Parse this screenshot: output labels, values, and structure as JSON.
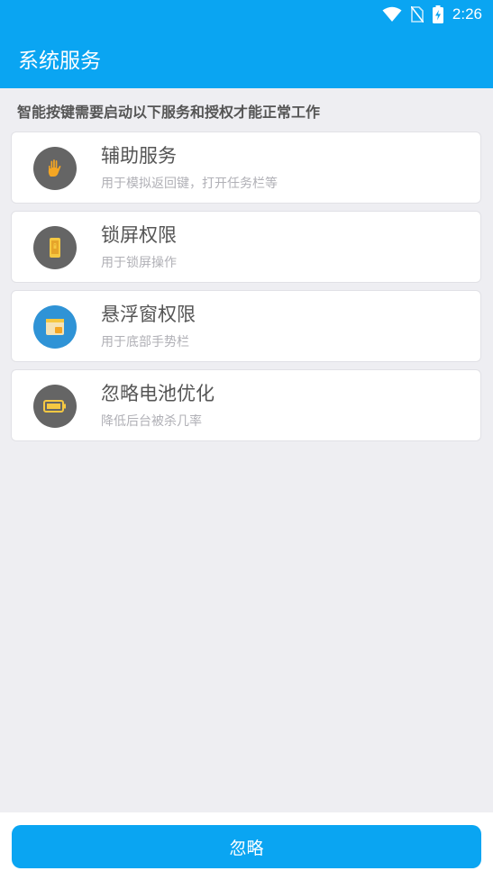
{
  "status_bar": {
    "time": "2:26",
    "icons": [
      "wifi-icon",
      "no-sim-icon",
      "battery-charging-icon"
    ]
  },
  "app_bar": {
    "title": "系统服务"
  },
  "subtitle": "智能按键需要启动以下服务和授权才能正常工作",
  "services": [
    {
      "title": "辅助服务",
      "desc": "用于模拟返回键，打开任务栏等",
      "icon": "hand-icon",
      "icon_bg": "#656565",
      "icon_color": "#f5a623"
    },
    {
      "title": "锁屏权限",
      "desc": "用于锁屏操作",
      "icon": "phone-lock-icon",
      "icon_bg": "#656565",
      "icon_color": "#f5c842"
    },
    {
      "title": "悬浮窗权限",
      "desc": "用于底部手势栏",
      "icon": "floating-window-icon",
      "icon_bg": "#2f93d6",
      "icon_color": "#f5c842"
    },
    {
      "title": "忽略电池优化",
      "desc": "降低后台被杀几率",
      "icon": "battery-icon",
      "icon_bg": "#656565",
      "icon_color": "#f5c842"
    }
  ],
  "ignore_button": {
    "label": "忽略"
  },
  "colors": {
    "primary": "#0aa5f2",
    "background": "#eeeef2"
  }
}
